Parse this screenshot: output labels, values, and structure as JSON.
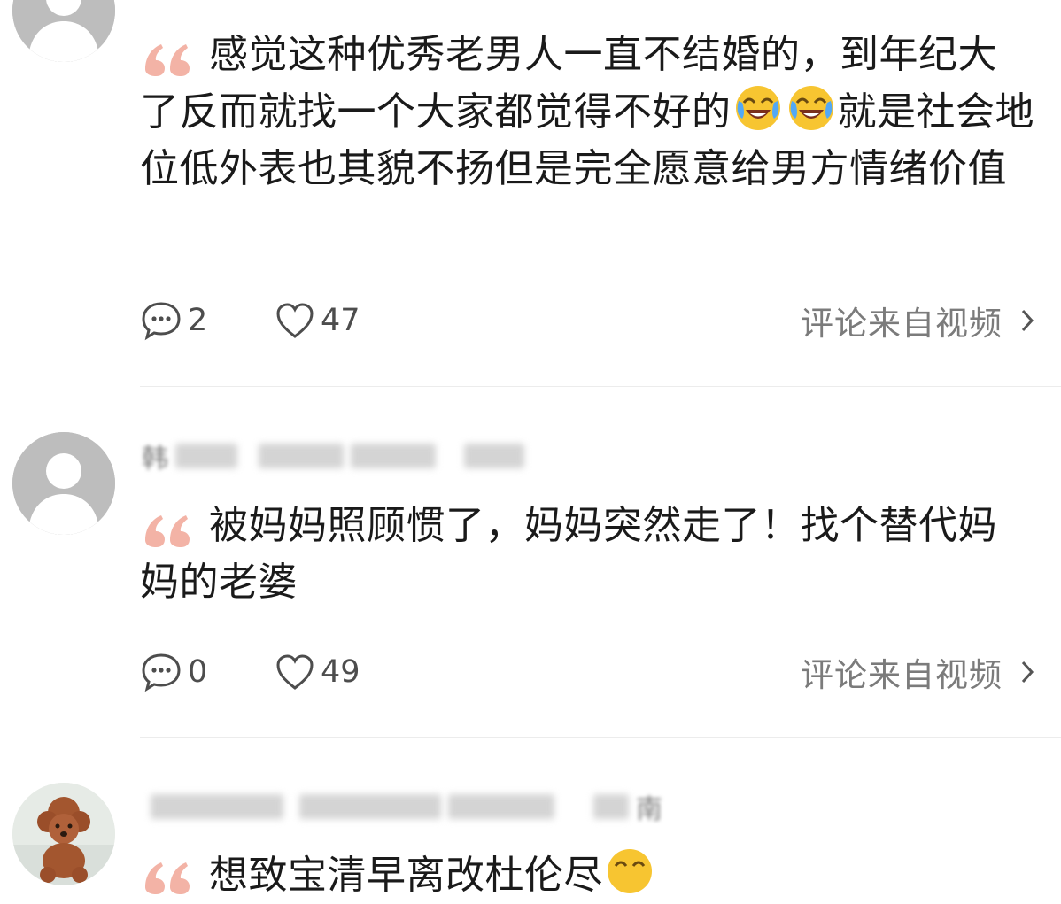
{
  "comments": [
    {
      "username": "",
      "body_part1": "感觉这种优秀老男人一直不结婚的，到年纪大了反而就找一个大家都觉得不好的",
      "body_part2": "就是社会地位低外表也其貌不扬但是完全愿意给男方情绪价值",
      "emoji": [
        "crying-laughing-emoji",
        "crying-laughing-emoji"
      ],
      "reply_count": "2",
      "like_count": "47",
      "source": "评论来自视频"
    },
    {
      "username_visible_prefix": "韩",
      "body": "被妈妈照顾惯了，妈妈突然走了！找个替代妈妈的老婆",
      "reply_count": "0",
      "like_count": "49",
      "source": "评论来自视频"
    },
    {
      "username_visible_suffix": "南",
      "body_partial": "想致宝清早离改杜伦尽"
    }
  ],
  "colors": {
    "quote_mark": "#f3b3a6",
    "text": "#1a1a1a",
    "meta": "#7b7b7b",
    "avatar_gray": "#bdbdbd"
  }
}
